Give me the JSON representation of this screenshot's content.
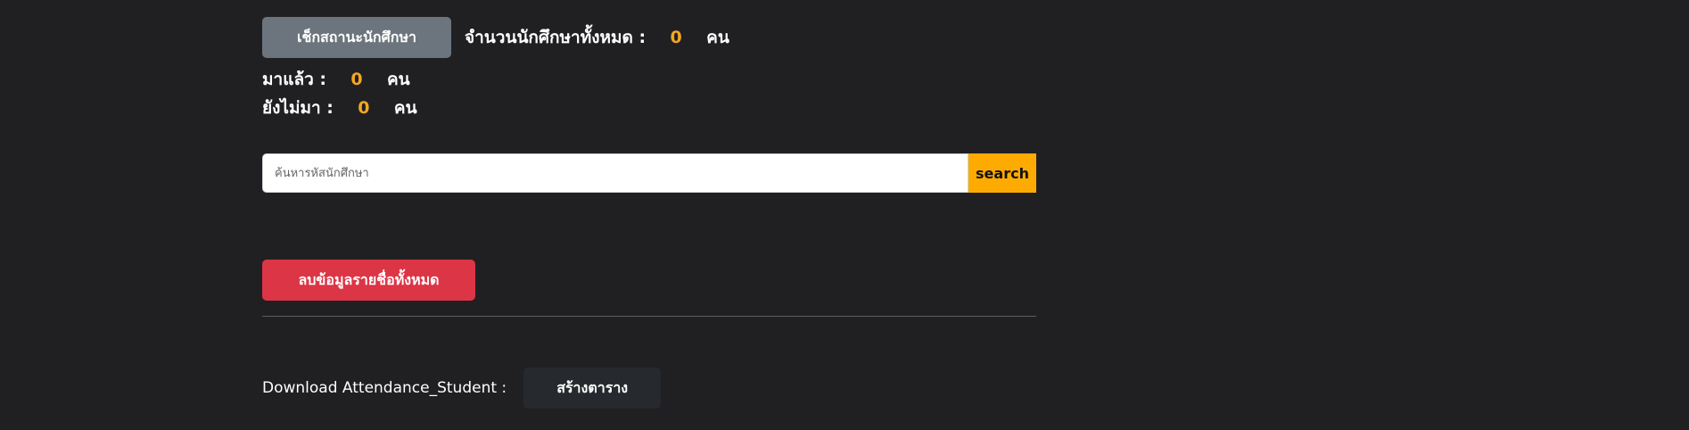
{
  "status": {
    "check_button_label": "เช็กสถานะนักศึกษา",
    "total_label": "จำนวนนักศึกษาทั้งหมด :",
    "total_value": "0",
    "unit": "คน",
    "arrived_label": "มาแล้ว :",
    "arrived_value": "0",
    "pending_label": "ยังไม่มา :",
    "pending_value": "0"
  },
  "search": {
    "placeholder": "ค้นหารหัสนักศึกษา",
    "value": "",
    "button_label": "search"
  },
  "actions": {
    "delete_all_label": "ลบข้อมูลรายชื่อทั้งหมด"
  },
  "download": {
    "label": "Download Attendance_Student :",
    "create_table_label": "สร้างตาราง"
  },
  "colors": {
    "background": "#202023",
    "accent_yellow": "#fdab00",
    "danger_red": "#dc3545",
    "secondary_gray": "#6c757d",
    "dark_button": "#26292d"
  }
}
